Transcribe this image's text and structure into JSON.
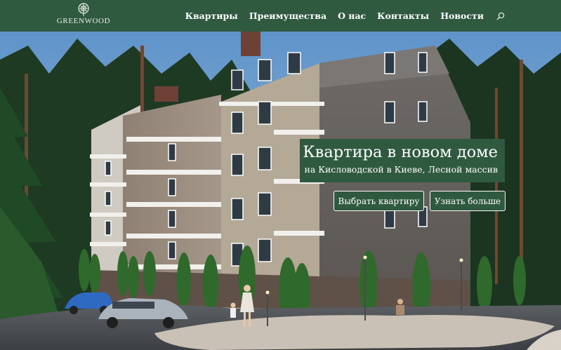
{
  "header": {
    "logo_text": "GREENWOOD",
    "nav": [
      {
        "label": "Квартиры"
      },
      {
        "label": "Преимущества"
      },
      {
        "label": "О нас"
      },
      {
        "label": "Контакты"
      },
      {
        "label": "Новости"
      }
    ],
    "search_icon": "search-icon"
  },
  "hero": {
    "title": "Квартира в новом доме",
    "subtitle": "на Кисловодской в Киеве, Лесной массив",
    "primary_button": "Выбрать квартиру",
    "secondary_button": "Узнать больше"
  },
  "colors": {
    "brand_green": "#2f5a3f",
    "text_white": "#ffffff",
    "sky": "#6f9fcf"
  }
}
